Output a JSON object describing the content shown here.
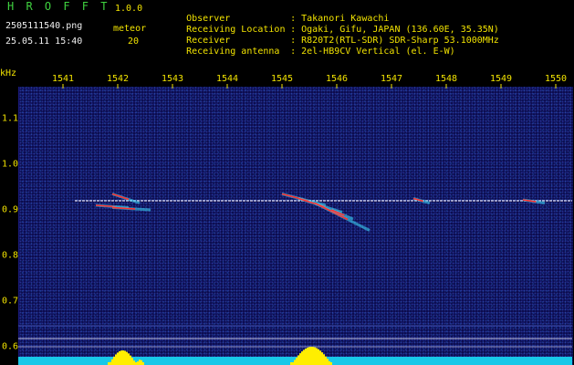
{
  "header": {
    "app_title": "H R O F F T",
    "app_version": "1.0.0",
    "filename": "2505111540.png",
    "datetime": "25.05.11 15:40",
    "meteor_label": "meteor",
    "meteor_count": "20",
    "info": [
      {
        "key": "Observer",
        "value": "Takanori Kawachi"
      },
      {
        "key": "Receiving Location",
        "value": "Ogaki, Gifu, JAPAN (136.60E, 35.35N)"
      },
      {
        "key": "Receiver",
        "value": "R820T2(RTL-SDR) SDR-Sharp 53.1000MHz"
      },
      {
        "key": "Receiving antenna",
        "value": "2el-HB9CV Vertical (el. E-W)"
      }
    ]
  },
  "axes": {
    "unit": "kHz",
    "x_ticks": [
      "1541",
      "1542",
      "1543",
      "1544",
      "1545",
      "1546",
      "1547",
      "1548",
      "1549",
      "1550"
    ],
    "y_ticks": [
      "1.1",
      "1.0",
      "0.9",
      "0.8",
      "0.7",
      "0.6"
    ]
  },
  "colors": {
    "label_yellow": "#f2e300",
    "label_green": "#3fd23f",
    "background_blue": "#0a0a4a",
    "carrier_white": "#e8e8ff",
    "echo_red": "#ff3030",
    "echo_cyan": "#40e0ff",
    "bar_yellow": "#ffee00",
    "baseline_cyan": "#18c8e8"
  },
  "chart_data": {
    "type": "heatmap",
    "x_unit": "minute",
    "y_unit": "kHz",
    "x_ticks": [
      1541,
      1542,
      1543,
      1544,
      1545,
      1546,
      1547,
      1548,
      1549,
      1550
    ],
    "y_ticks": [
      1.1,
      1.0,
      0.9,
      0.8,
      0.7,
      0.6
    ],
    "xlim": [
      1540.4,
      1550.3
    ],
    "ylim": [
      0.59,
      1.2
    ],
    "carrier_khz": 0.92,
    "echo_streaks": [
      {
        "x": [
          1541.9,
          1542.4
        ],
        "y": [
          0.935,
          0.915
        ]
      },
      {
        "x": [
          1541.6,
          1542.2
        ],
        "y": [
          0.91,
          0.905
        ]
      },
      {
        "x": [
          1541.9,
          1542.6
        ],
        "y": [
          0.905,
          0.9
        ]
      },
      {
        "x": [
          1545.0,
          1545.8
        ],
        "y": [
          0.935,
          0.91
        ]
      },
      {
        "x": [
          1545.3,
          1546.1
        ],
        "y": [
          0.925,
          0.895
        ]
      },
      {
        "x": [
          1545.6,
          1546.6
        ],
        "y": [
          0.915,
          0.855
        ]
      },
      {
        "x": [
          1545.9,
          1546.3
        ],
        "y": [
          0.9,
          0.88
        ]
      },
      {
        "x": [
          1547.4,
          1547.7
        ],
        "y": [
          0.925,
          0.915
        ]
      },
      {
        "x": [
          1549.4,
          1549.8
        ],
        "y": [
          0.922,
          0.915
        ]
      }
    ]
  }
}
